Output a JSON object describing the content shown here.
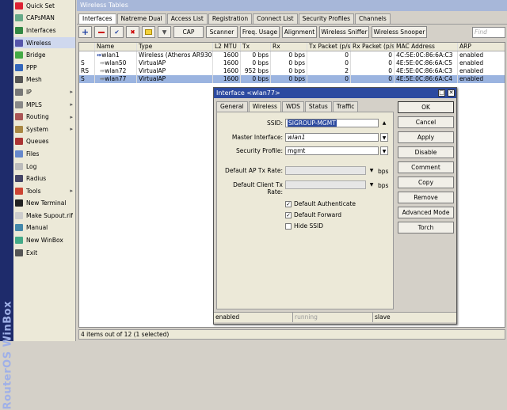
{
  "brand": "RouterOS WinBox",
  "sidebar": {
    "items": [
      {
        "label": "Quick Set",
        "color": "#d23"
      },
      {
        "label": "CAPsMAN",
        "color": "#6a8"
      },
      {
        "label": "Interfaces",
        "color": "#384"
      },
      {
        "label": "Wireless",
        "color": "#55a"
      },
      {
        "label": "Bridge",
        "color": "#4a4"
      },
      {
        "label": "PPP",
        "color": "#36b"
      },
      {
        "label": "Mesh",
        "color": "#555"
      },
      {
        "label": "IP",
        "color": "#777",
        "arrow": "▸"
      },
      {
        "label": "MPLS",
        "color": "#888",
        "arrow": "▸"
      },
      {
        "label": "Routing",
        "color": "#a55",
        "arrow": "▸"
      },
      {
        "label": "System",
        "color": "#a84",
        "arrow": "▸"
      },
      {
        "label": "Queues",
        "color": "#a33"
      },
      {
        "label": "Files",
        "color": "#68c"
      },
      {
        "label": "Log",
        "color": "#bbb"
      },
      {
        "label": "Radius",
        "color": "#446"
      },
      {
        "label": "Tools",
        "color": "#c43",
        "arrow": "▸"
      },
      {
        "label": "New Terminal",
        "color": "#222"
      },
      {
        "label": "Make Supout.rif",
        "color": "#ccc"
      },
      {
        "label": "Manual",
        "color": "#48a"
      },
      {
        "label": "New WinBox",
        "color": "#4a8"
      },
      {
        "label": "Exit",
        "color": "#555"
      }
    ]
  },
  "main": {
    "title": "Wireless Tables",
    "tabs": [
      "Interfaces",
      "Natreme Dual",
      "Access List",
      "Registration",
      "Connect List",
      "Security Profiles",
      "Channels"
    ],
    "toolbar": {
      "cap": "CAP",
      "scanner": "Scanner",
      "freq_usage": "Freq. Usage",
      "alignment": "Alignment",
      "sniffer": "Wireless Sniffer",
      "snooper": "Wireless Snooper",
      "find_placeholder": "Find"
    },
    "columns": [
      "",
      "Name",
      "Type",
      "L2 MTU",
      "Tx",
      "Rx",
      "Tx Packet (p/s)",
      "Rx Packet (p/s)",
      "MAC Address",
      "ARP"
    ],
    "rows": [
      {
        "flag": "",
        "name": "wlan1",
        "type": "Wireless (Atheros AR9300)",
        "mtu": "1600",
        "tx": "0 bps",
        "rx": "0 bps",
        "txp": "0",
        "rxp": "0",
        "mac": "4C:5E:0C:86:6A:C3",
        "arp": "enabled"
      },
      {
        "flag": "S",
        "name": "wlan50",
        "type": "VirtualAP",
        "mtu": "1600",
        "tx": "0 bps",
        "rx": "0 bps",
        "txp": "0",
        "rxp": "0",
        "mac": "4E:5E:0C:86:6A:C5",
        "arp": "enabled"
      },
      {
        "flag": "RS",
        "name": "wlan72",
        "type": "VirtualAP",
        "mtu": "1600",
        "tx": "952 bps",
        "rx": "0 bps",
        "txp": "2",
        "rxp": "0",
        "mac": "4E:5E:0C:86:6A:C3",
        "arp": "enabled"
      },
      {
        "flag": "S",
        "name": "wlan77",
        "type": "VirtualAP",
        "mtu": "1600",
        "tx": "0 bps",
        "rx": "0 bps",
        "txp": "0",
        "rxp": "0",
        "mac": "4E:5E:0C:86:6A:C4",
        "arp": "enabled"
      }
    ],
    "status": "4 items out of 12 (1 selected)"
  },
  "dialog": {
    "title": "Interface <wlan77>",
    "tabs": [
      "General",
      "Wireless",
      "WDS",
      "Status",
      "Traffic"
    ],
    "ssid_label": "SSID:",
    "ssid": "SIGROUP-MGMT",
    "master_label": "Master Interface:",
    "master": "wlan1",
    "secprof_label": "Security Profile:",
    "secprof": "mgmt",
    "ap_tx_label": "Default AP Tx Rate:",
    "ap_tx_unit": "bps",
    "client_tx_label": "Default Client Tx Rate:",
    "client_tx_unit": "bps",
    "chk_auth": "Default Authenticate",
    "chk_fwd": "Default Forward",
    "chk_hide": "Hide SSID",
    "buttons": [
      "OK",
      "Cancel",
      "Apply",
      "Disable",
      "Comment",
      "Copy",
      "Remove",
      "Advanced Mode",
      "Torch"
    ],
    "status": [
      "enabled",
      "running",
      "slave"
    ]
  }
}
